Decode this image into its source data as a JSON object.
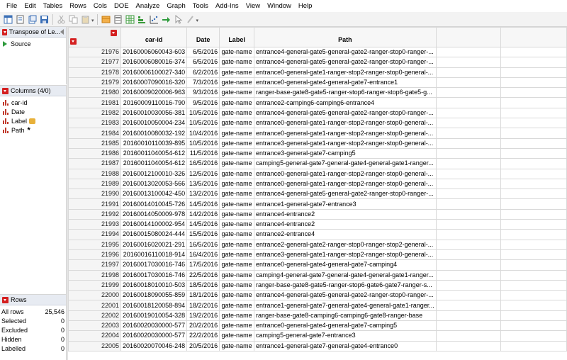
{
  "menu": [
    "File",
    "Edit",
    "Tables",
    "Rows",
    "Cols",
    "DOE",
    "Analyze",
    "Graph",
    "Tools",
    "Add-Ins",
    "View",
    "Window",
    "Help"
  ],
  "toolbar_icons": [
    "new-data-table-icon",
    "new-script-icon",
    "open-icon",
    "save-icon",
    "cut-icon",
    "copy-icon",
    "paste-icon",
    "data-table-icon",
    "report-icon",
    "grid-icon",
    "distribution-icon",
    "fit-y-by-x-icon",
    "run-script-icon",
    "pointer-icon",
    "brush-icon"
  ],
  "table_panel": {
    "title": "Transpose of Le...",
    "source_label": "Source"
  },
  "columns_panel": {
    "title": "Columns (4/0)",
    "items": [
      {
        "name": "car-id",
        "badge": ""
      },
      {
        "name": "Date",
        "badge": ""
      },
      {
        "name": "Label",
        "badge": "key"
      },
      {
        "name": "Path",
        "badge": "*"
      }
    ]
  },
  "rows_panel": {
    "title": "Rows",
    "items": [
      {
        "label": "All rows",
        "value": "25,546"
      },
      {
        "label": "Selected",
        "value": "0"
      },
      {
        "label": "Excluded",
        "value": "0"
      },
      {
        "label": "Hidden",
        "value": "0"
      },
      {
        "label": "Labelled",
        "value": "0"
      }
    ]
  },
  "grid": {
    "headers": [
      "car-id",
      "Date",
      "Label",
      "Path"
    ],
    "rows": [
      [
        "21976",
        "20160006060043-603",
        "6/5/2016",
        "gate-name",
        "entrance4-general-gate5-general-gate2-ranger-stop0-ranger-..."
      ],
      [
        "21977",
        "20160006080016-374",
        "6/5/2016",
        "gate-name",
        "entrance4-general-gate5-general-gate2-ranger-stop0-ranger-..."
      ],
      [
        "21978",
        "20160006100027-340",
        "6/2/2016",
        "gate-name",
        "entrance0-general-gate1-ranger-stop2-ranger-stop0-general-..."
      ],
      [
        "21979",
        "20160007090016-320",
        "7/3/2016",
        "gate-name",
        "entrance0-general-gate4-general-gate7-entrance1"
      ],
      [
        "21980",
        "20160009020006-963",
        "9/3/2016",
        "gate-name",
        "ranger-base-gate8-gate5-ranger-stop6-ranger-stop6-gate5-g..."
      ],
      [
        "21981",
        "20160009110016-790",
        "9/5/2016",
        "gate-name",
        "entrance2-camping6-camping6-entrance4"
      ],
      [
        "21982",
        "20160010030056-381",
        "10/5/2016",
        "gate-name",
        "entrance4-general-gate5-general-gate2-ranger-stop0-ranger-..."
      ],
      [
        "21983",
        "20160010050004-234",
        "10/5/2016",
        "gate-name",
        "entrance0-general-gate1-ranger-stop2-ranger-stop0-general-..."
      ],
      [
        "21984",
        "20160010080032-192",
        "10/4/2016",
        "gate-name",
        "entrance0-general-gate1-ranger-stop2-ranger-stop0-general-..."
      ],
      [
        "21985",
        "20160010110039-895",
        "10/5/2016",
        "gate-name",
        "entrance3-general-gate1-ranger-stop2-ranger-stop0-general-..."
      ],
      [
        "21986",
        "20160011040054-612",
        "11/5/2016",
        "gate-name",
        "entrance3-general-gate7-camping5"
      ],
      [
        "21987",
        "20160011040054-612",
        "16/5/2016",
        "gate-name",
        "camping5-general-gate7-general-gate4-general-gate1-ranger..."
      ],
      [
        "21988",
        "20160012100010-326",
        "12/5/2016",
        "gate-name",
        "entrance0-general-gate1-ranger-stop2-ranger-stop0-general-..."
      ],
      [
        "21989",
        "20160013020053-566",
        "13/5/2016",
        "gate-name",
        "entrance0-general-gate1-ranger-stop2-ranger-stop0-general-..."
      ],
      [
        "21990",
        "20160013100042-450",
        "13/2/2016",
        "gate-name",
        "entrance4-general-gate5-general-gate2-ranger-stop0-ranger-..."
      ],
      [
        "21991",
        "20160014010045-726",
        "14/5/2016",
        "gate-name",
        "entrance1-general-gate7-entrance3"
      ],
      [
        "21992",
        "20160014050009-978",
        "14/2/2016",
        "gate-name",
        "entrance4-entrance2"
      ],
      [
        "21993",
        "20160014100002-954",
        "14/5/2016",
        "gate-name",
        "entrance4-entrance2"
      ],
      [
        "21994",
        "20160015080024-444",
        "15/5/2016",
        "gate-name",
        "entrance2-entrance4"
      ],
      [
        "21995",
        "20160016020021-291",
        "16/5/2016",
        "gate-name",
        "entrance2-general-gate2-ranger-stop0-ranger-stop2-general-..."
      ],
      [
        "21996",
        "20160016110018-914",
        "16/4/2016",
        "gate-name",
        "entrance3-general-gate1-ranger-stop2-ranger-stop0-general-..."
      ],
      [
        "21997",
        "20160017030016-746",
        "17/5/2016",
        "gate-name",
        "entrance0-general-gate4-general-gate7-camping4"
      ],
      [
        "21998",
        "20160017030016-746",
        "22/5/2016",
        "gate-name",
        "camping4-general-gate7-general-gate4-general-gate1-ranger..."
      ],
      [
        "21999",
        "20160018010010-503",
        "18/5/2016",
        "gate-name",
        "ranger-base-gate8-gate5-ranger-stop6-gate6-gate7-ranger-s..."
      ],
      [
        "22000",
        "20160018090055-859",
        "18/1/2016",
        "gate-name",
        "entrance4-general-gate5-general-gate2-ranger-stop0-ranger-..."
      ],
      [
        "22001",
        "20160018120058-894",
        "18/2/2016",
        "gate-name",
        "entrance1-general-gate7-general-gate4-general-gate1-ranger..."
      ],
      [
        "22002",
        "20160019010054-328",
        "19/2/2016",
        "gate-name",
        "ranger-base-gate8-camping6-camping6-gate8-ranger-base"
      ],
      [
        "22003",
        "20160020030000-577",
        "20/2/2016",
        "gate-name",
        "entrance0-general-gate4-general-gate7-camping5"
      ],
      [
        "22004",
        "20160020030000-577",
        "22/2/2016",
        "gate-name",
        "camping5-general-gate7-entrance3"
      ],
      [
        "22005",
        "20160020070046-248",
        "20/5/2016",
        "gate-name",
        "entrance1-general-gate7-general-gate4-entrance0"
      ]
    ]
  },
  "colors": {
    "red_menu": "#d42020",
    "green_source": "#2e9b3c",
    "panel_head": "#e7ebf2"
  }
}
